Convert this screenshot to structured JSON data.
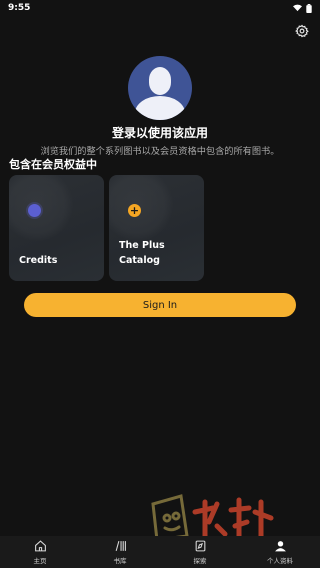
{
  "status_bar": {
    "time": "9:55"
  },
  "login": {
    "title": "登录以使用该应用",
    "subtitle": "浏览我们的整个系列图书以及会员资格中包含的所有图书。"
  },
  "benefits": {
    "title": "包含在会员权益中",
    "cards": [
      {
        "label": "Credits",
        "icon": "credits-dot-icon",
        "color": "#5b5fd1"
      },
      {
        "label_lines": [
          "The Plus",
          "Catalog"
        ],
        "icon": "plus-icon",
        "color": "#f5a623"
      }
    ]
  },
  "signin_button": {
    "label": "Sign In",
    "color": "#f7b230"
  },
  "bottom_nav": [
    {
      "label": "主页",
      "icon": "home-icon"
    },
    {
      "label": "书库",
      "icon": "library-icon"
    },
    {
      "label": "探索",
      "icon": "explore-icon"
    },
    {
      "label": "个人资料",
      "icon": "profile-icon"
    }
  ],
  "colors": {
    "background": "#121212",
    "card": "#2a2e33",
    "accent": "#f7b230"
  }
}
